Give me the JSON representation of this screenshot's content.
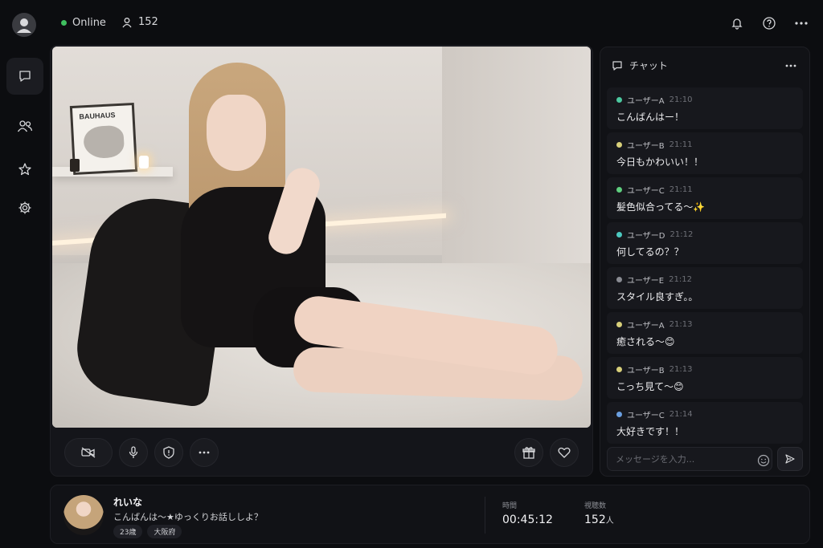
{
  "topbar": {
    "status_label": "Online",
    "viewer_count": "152"
  },
  "chat": {
    "title": "チャット",
    "input_placeholder": "メッセージを入力...",
    "messages": [
      {
        "user": "ユーザーA",
        "time": "21:10",
        "text": "こんばんはー！",
        "color": "#4cc9a0"
      },
      {
        "user": "ユーザーB",
        "time": "21:11",
        "text": "今日もかわいい！！",
        "color": "#d8d07a"
      },
      {
        "user": "ユーザーC",
        "time": "21:11",
        "text": "髪色似合ってる〜✨",
        "color": "#5fcf7f"
      },
      {
        "user": "ユーザーD",
        "time": "21:12",
        "text": "何してるの？？",
        "color": "#4cc9c0"
      },
      {
        "user": "ユーザーE",
        "time": "21:12",
        "text": "スタイル良すぎ。。",
        "color": "#8a8c93"
      },
      {
        "user": "ユーザーA",
        "time": "21:13",
        "text": "癒される〜😊",
        "color": "#d8d07a"
      },
      {
        "user": "ユーザーB",
        "time": "21:13",
        "text": "こっち見て〜😊",
        "color": "#d8d07a"
      },
      {
        "user": "ユーザーC",
        "time": "21:14",
        "text": "大好きです！！",
        "color": "#6a9fe0"
      }
    ]
  },
  "video": {
    "poster_text": "BAUHAUS"
  },
  "profile": {
    "name": "れいな",
    "message": "こんばんは〜★ゆっくりお話ししよ？",
    "tags": [
      "23歳",
      "大阪府"
    ],
    "time_label": "時間",
    "time_value": "00:45:12",
    "viewers_label": "視聴数",
    "viewers_value": "152",
    "viewers_unit": "人"
  }
}
